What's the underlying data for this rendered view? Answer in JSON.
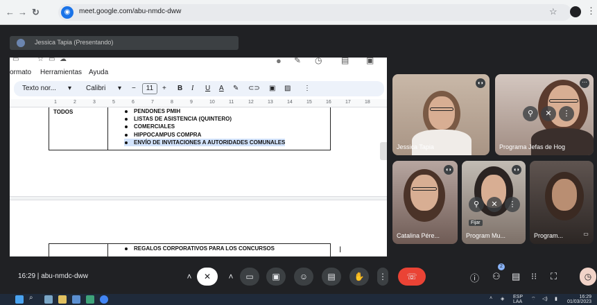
{
  "browser": {
    "url": "meet.google.com/abu-nmdc-dww",
    "icons": {
      "back": "back-icon",
      "forward": "forward-icon",
      "reload": "reload-icon",
      "bookmark": "star-icon",
      "menu": "kebab-icon"
    }
  },
  "meet": {
    "presenter_label": "Jessica Tapia (Presentando)",
    "meeting_time": "16:29",
    "meeting_code": "abu-nmdc-dww",
    "participants_badge": "2"
  },
  "doc": {
    "menu": [
      "ormato",
      "Herramientas",
      "Ayuda"
    ],
    "toolbar": {
      "style": "Texto nor...",
      "font": "Calibri",
      "size": "11"
    },
    "ruler": [
      "1",
      "2",
      "3",
      "5",
      "6",
      "7",
      "8",
      "9",
      "10",
      "11",
      "12",
      "13",
      "14",
      "15",
      "16",
      "17",
      "18"
    ],
    "table1": {
      "category": "TODOS",
      "items": [
        "PENDONES PMIH",
        "LISTAS DE ASISTENCIA (QUINTERO)",
        "COMERCIALES",
        "HIPPOCAMPUS COMPRA",
        "ENVÍO DE INVITACIONES A AUTORIDADES COMUNALES"
      ]
    },
    "table2": {
      "items": [
        "REGALOS CORPORATIVOS PARA LOS CONCURSOS"
      ]
    }
  },
  "tiles": [
    {
      "name": "Jessica Tapia"
    },
    {
      "name": "Programa Jefas de Hog"
    },
    {
      "name": "Catalina Pére..."
    },
    {
      "name": "Program  Mu...",
      "pin_label": "Fijar"
    },
    {
      "name": "Program..."
    }
  ],
  "taskbar": {
    "lang": "ESP",
    "lang2": "LAA",
    "time": "16:29",
    "date": "01/03/2023"
  },
  "colors": {
    "meet_bg": "#202124",
    "leave": "#ea4335",
    "doc_toolbar": "#edf2fa"
  }
}
